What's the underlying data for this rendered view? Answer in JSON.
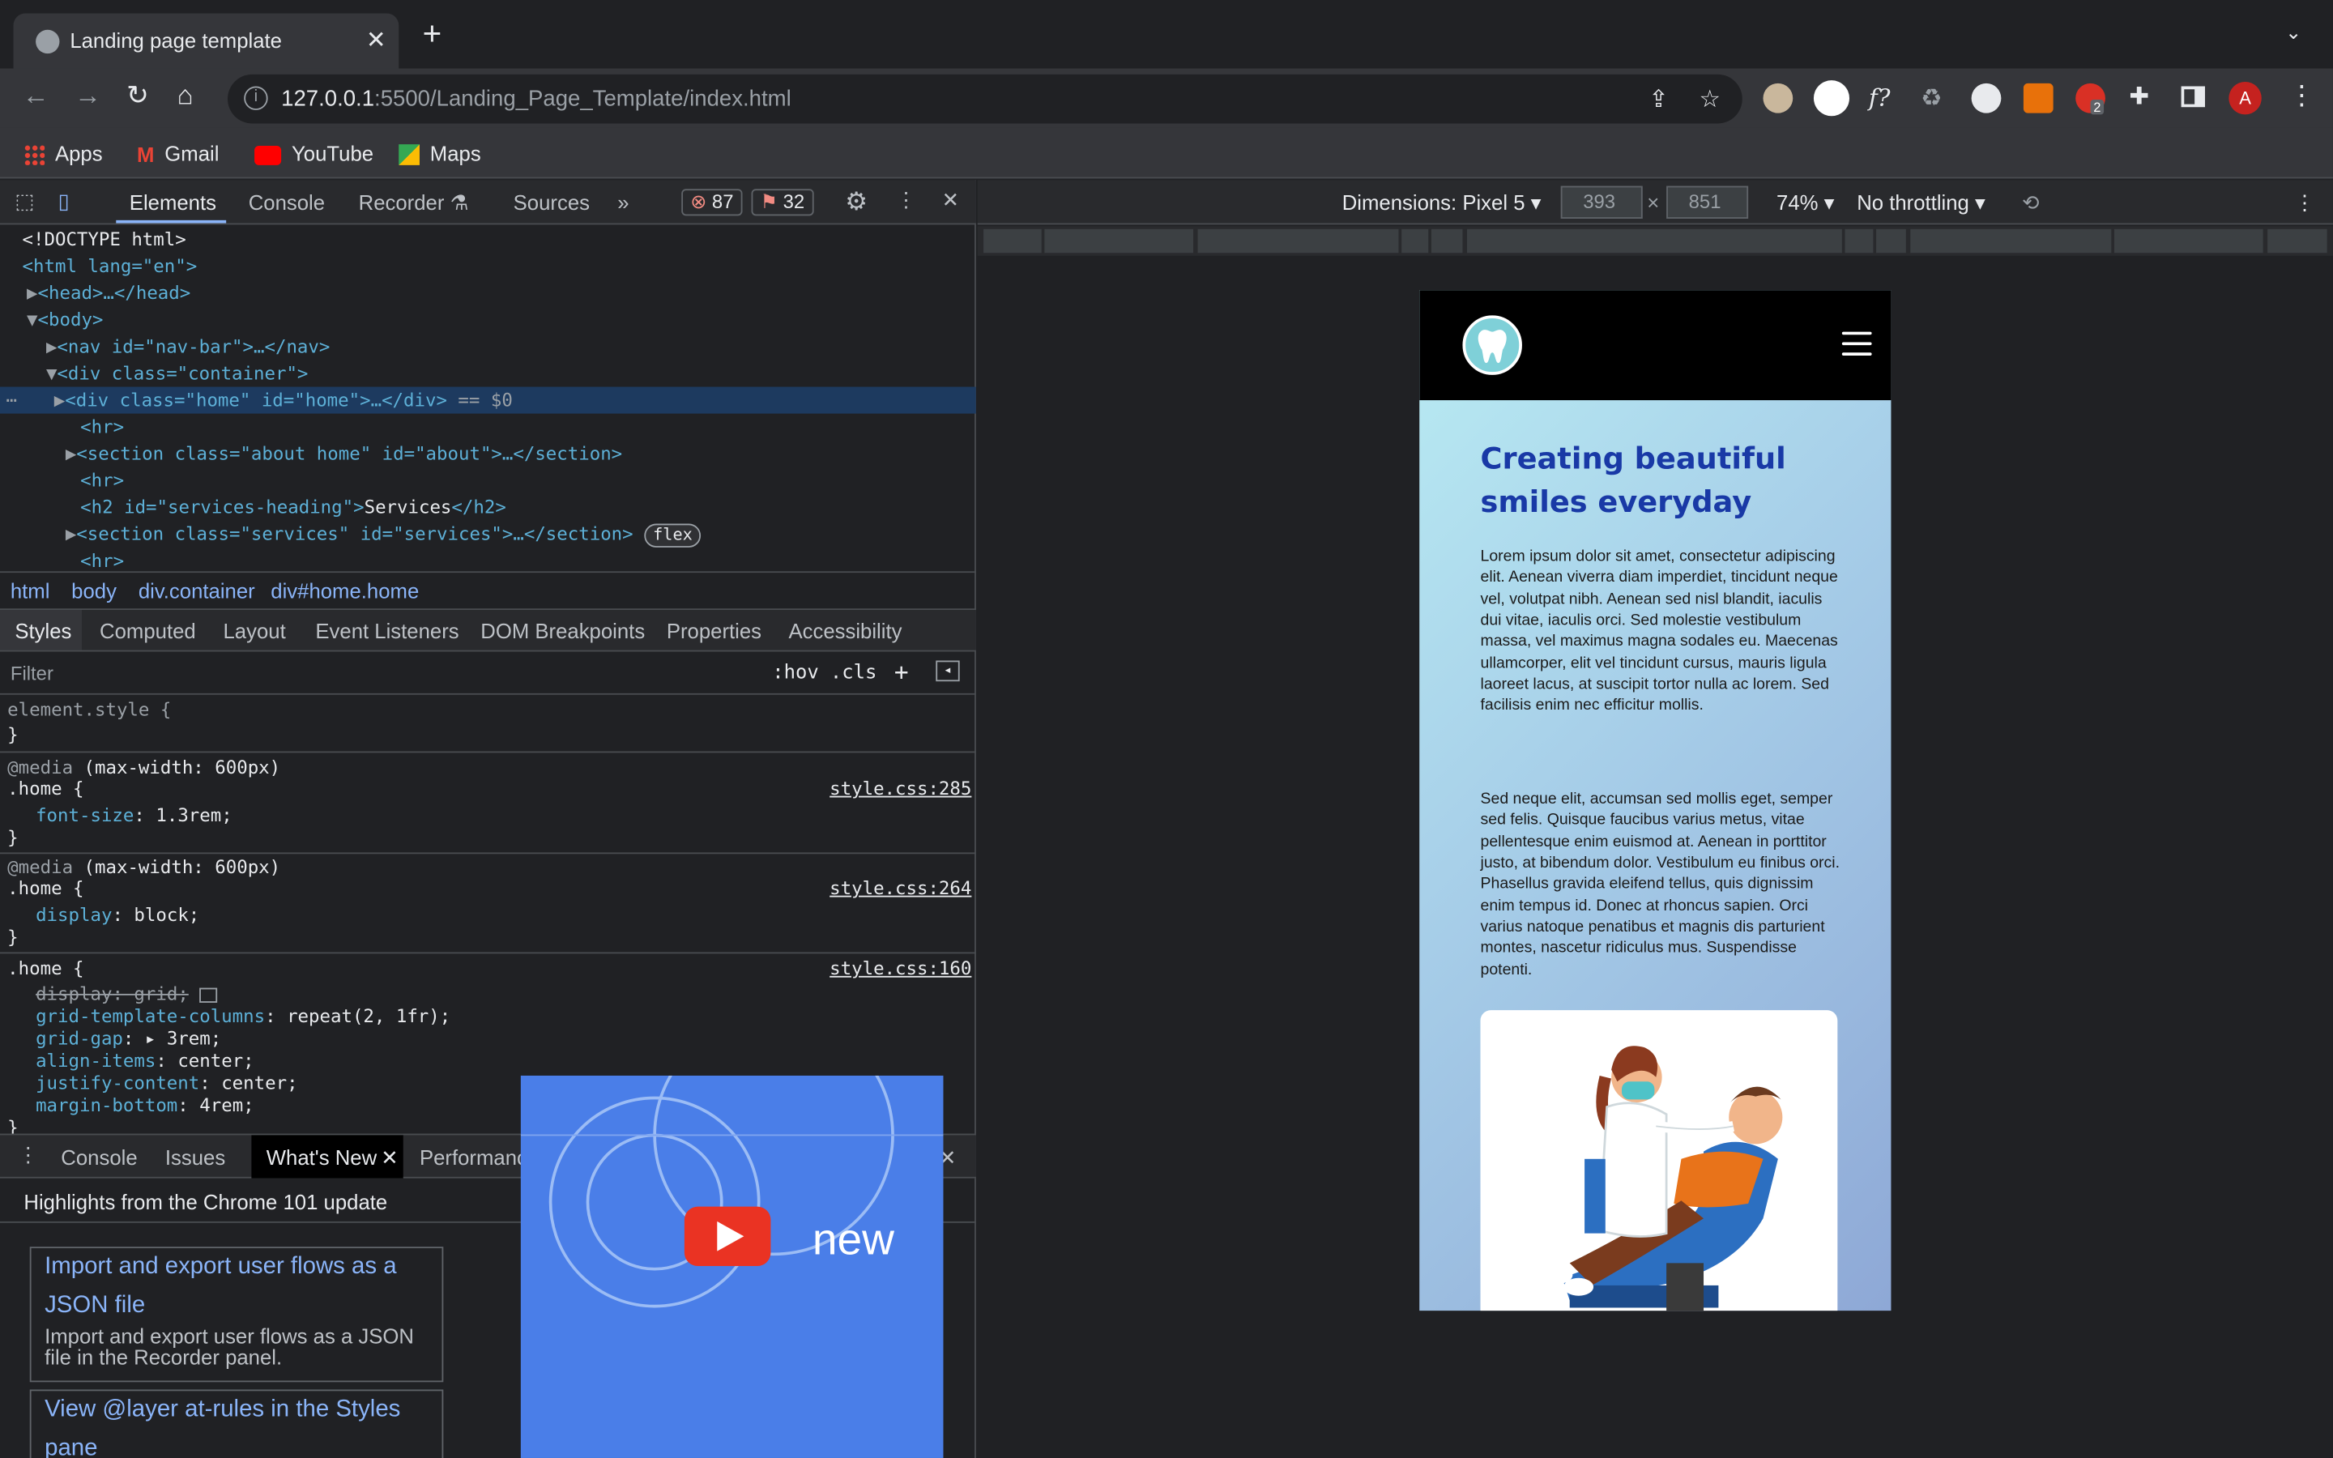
{
  "browser": {
    "tab_title": "Landing page template",
    "url_host": "127.0.0.1",
    "url_rest": ":5500/Landing_Page_Template/index.html",
    "avatar_letter": "A",
    "ext_badge": "2",
    "bookmarks": [
      "Apps",
      "Gmail",
      "YouTube",
      "Maps"
    ]
  },
  "devtools": {
    "tabs": [
      "Elements",
      "Console",
      "Recorder",
      "Sources"
    ],
    "more": "»",
    "error_count": "87",
    "warning_count": "32",
    "dom": {
      "doctype": "<!DOCTYPE html>",
      "html_open": "<html lang=\"en\">",
      "head": "<head>…</head>",
      "body": "<body>",
      "nav": "<nav id=\"nav-bar\">…</nav>",
      "container": "<div class=\"container\">",
      "home": "<div class=\"home\" id=\"home\">…</div>",
      "eq": "== $0",
      "hr": "<hr>",
      "about": "<section class=\"about home\" id=\"about\">…</section>",
      "h2_open": "<h2 id=\"services-heading\">",
      "h2_text": "Services",
      "h2_close": "</h2>",
      "services": "<section class=\"services\" id=\"services\">…</section>",
      "flex": "flex"
    },
    "breadcrumbs": [
      "html",
      "body",
      "div.container",
      "div#home.home"
    ],
    "subtabs": [
      "Styles",
      "Computed",
      "Layout",
      "Event Listeners",
      "DOM Breakpoints",
      "Properties",
      "Accessibility"
    ],
    "filter_placeholder": "Filter",
    "hov": ":hov",
    "cls": ".cls",
    "styles": {
      "element_style": "element.style {",
      "close": "}",
      "media1": "(max-width: 600px)",
      "media_kw": "@media",
      "selector": ".home {",
      "src1": "style.css:285",
      "rule1_prop": "font-size",
      "rule1_val": "1.3rem;",
      "src2": "style.css:264",
      "rule2_prop": "display",
      "rule2_val": "block;",
      "src3": "style.css:160",
      "rule3": [
        {
          "prop": "display",
          "val": "grid;",
          "struck": true
        },
        {
          "prop": "grid-template-columns",
          "val": "repeat(2, 1fr);"
        },
        {
          "prop": "grid-gap",
          "val": "▸ 3rem;"
        },
        {
          "prop": "align-items",
          "val": "center;"
        },
        {
          "prop": "justify-content",
          "val": "center;"
        },
        {
          "prop": "margin-bottom",
          "val": "4rem;"
        }
      ]
    },
    "drawer_tabs": [
      "Console",
      "Issues",
      "What's New",
      "Performance monitor"
    ],
    "whats_new_heading": "Highlights from the Chrome 101 update",
    "cards": [
      {
        "title": "Import and export user flows as a JSON file",
        "desc": "Import and export user flows as a JSON file in the Recorder panel."
      },
      {
        "title": "View @layer at-rules in the Styles pane",
        "desc": ""
      }
    ],
    "video_text": "new"
  },
  "device": {
    "dimensions_label": "Dimensions: Pixel 5",
    "width": "393",
    "height": "851",
    "times": "×",
    "zoom": "74%",
    "throttling": "No throttling"
  },
  "page": {
    "hero_title": "Creating beautiful smiles everyday",
    "para1": "Lorem ipsum dolor sit amet, consectetur adipiscing elit. Aenean viverra diam imperdiet, tincidunt neque vel, volutpat nibh. Aenean sed nisl blandit, iaculis dui vitae, iaculis orci. Sed molestie vestibulum massa, vel maximus magna sodales eu. Maecenas ullamcorper, elit vel tincidunt cursus, mauris ligula laoreet lacus, at suscipit tortor nulla ac lorem. Sed facilisis enim nec efficitur mollis.",
    "para2": "Sed neque elit, accumsan sed mollis eget, semper sed felis. Quisque faucibus varius metus, vitae pellentesque enim euismod at. Aenean in porttitor justo, at bibendum dolor. Vestibulum eu finibus orci. Phasellus gravida eleifend tellus, quis dignissim enim tempus id. Donec at rhoncus sapien. Orci varius natoque penatibus et magnis dis parturient montes, nascetur ridiculus mus. Suspendisse potenti."
  },
  "colors": {
    "accent_blue": "#8ab4f8",
    "hero_title": "#1939a6",
    "selected_row": "#1d3a5f"
  }
}
